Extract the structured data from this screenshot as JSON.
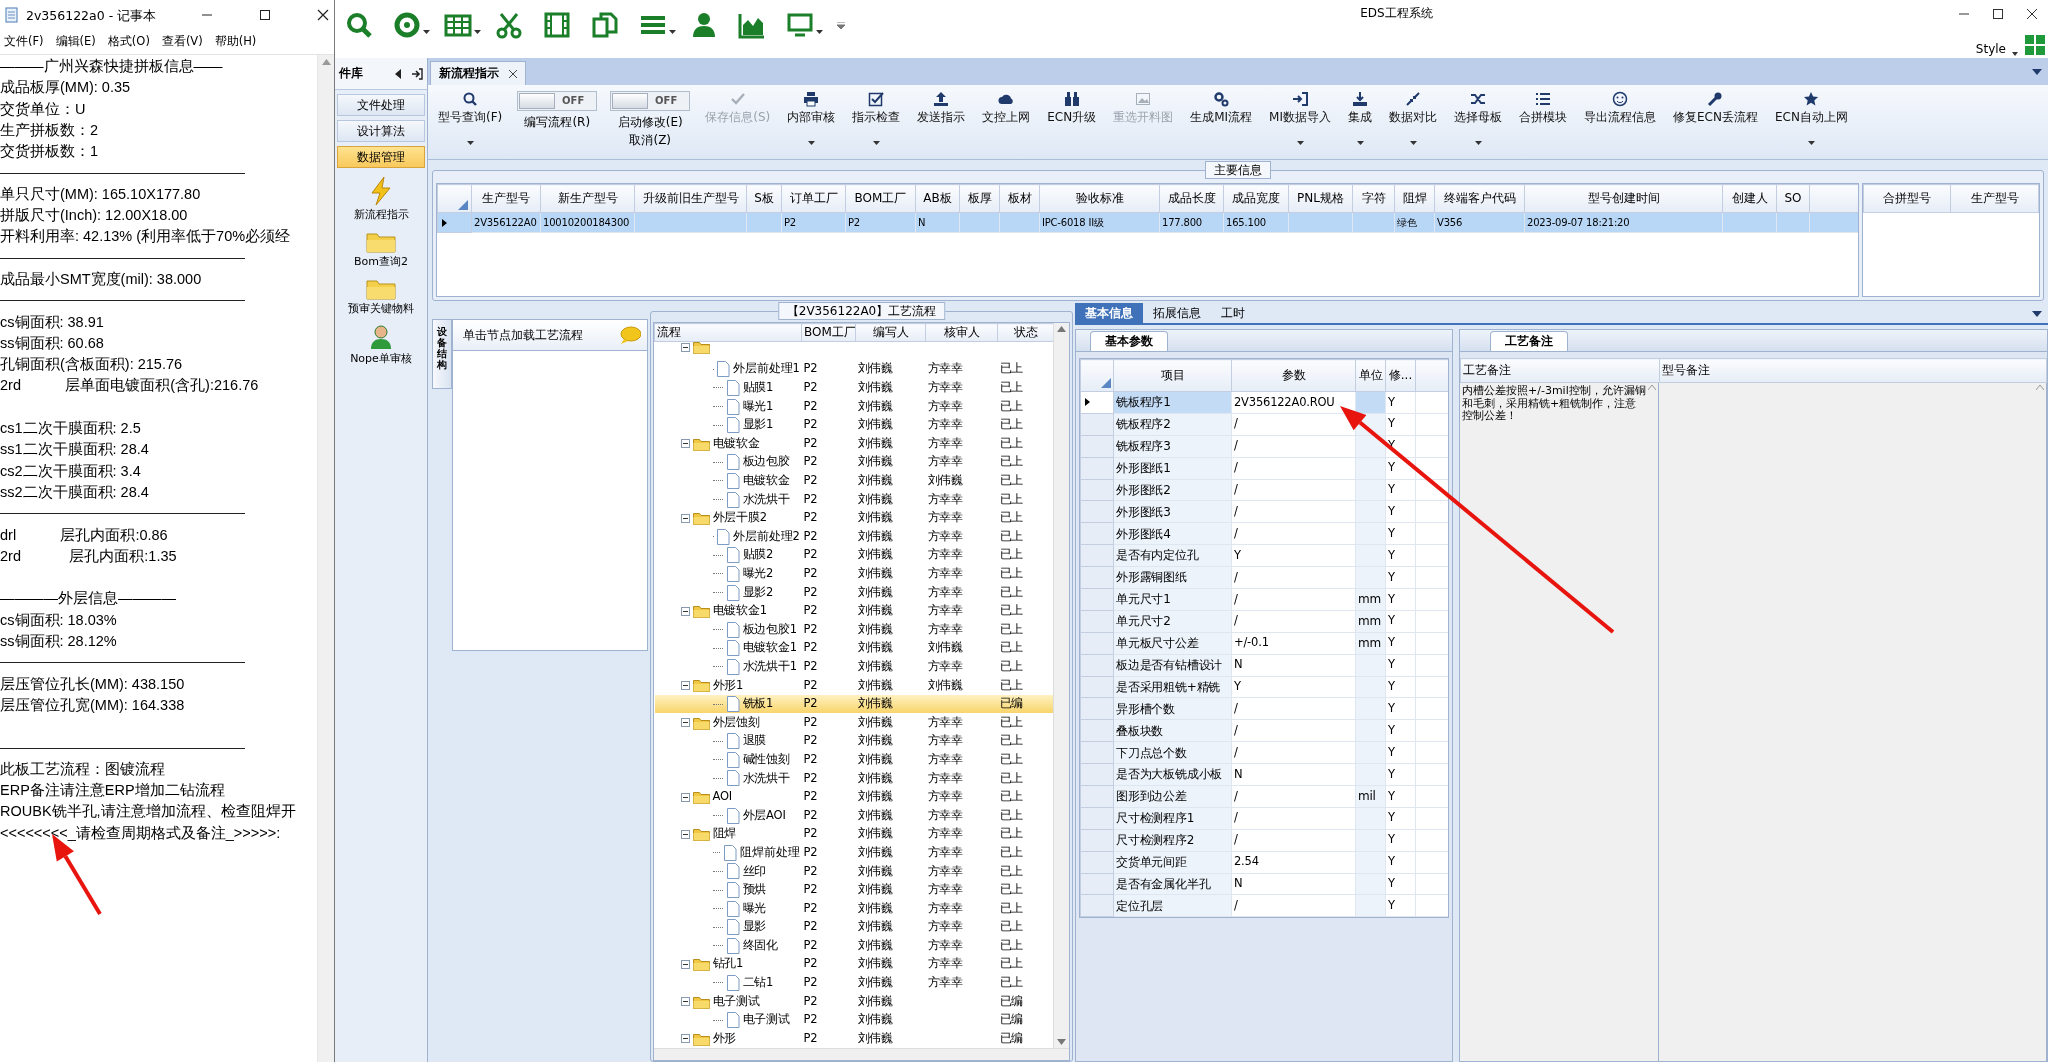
{
  "notepad": {
    "title": "2v356122a0 - 记事本",
    "menu": [
      "文件(F)",
      "编辑(E)",
      "格式(O)",
      "查看(V)",
      "帮助(H)"
    ],
    "lines": [
      {
        "kind": "text",
        "text": "———广州兴森快捷拼板信息——"
      },
      {
        "kind": "text",
        "text": "成品板厚(MM): 0.35"
      },
      {
        "kind": "text",
        "text": "交货单位：U"
      },
      {
        "kind": "text",
        "text": "生产拼板数：2"
      },
      {
        "kind": "text",
        "text": "交货拼板数：1"
      },
      {
        "kind": "rule"
      },
      {
        "kind": "text",
        "text": "单只尺寸(MM): 165.10X177.80"
      },
      {
        "kind": "text",
        "text": "拼版尺寸(Inch): 12.00X18.00"
      },
      {
        "kind": "text",
        "text": "开料利用率: 42.13% (利用率低于70%必须经"
      },
      {
        "kind": "rule"
      },
      {
        "kind": "text",
        "text": "成品最小SMT宽度(mil): 38.000"
      },
      {
        "kind": "rule"
      },
      {
        "kind": "text",
        "text": "cs铜面积: 38.91"
      },
      {
        "kind": "text",
        "text": "ss铜面积: 60.68"
      },
      {
        "kind": "text",
        "text": "孔铜面积(含板面积): 215.76"
      },
      {
        "kind": "text",
        "text": "2rd           层单面电镀面积(含孔):216.76"
      },
      {
        "kind": "blank"
      },
      {
        "kind": "text",
        "text": "cs1二次干膜面积: 2.5"
      },
      {
        "kind": "text",
        "text": "ss1二次干膜面积: 28.4"
      },
      {
        "kind": "text",
        "text": "cs2二次干膜面积: 3.4"
      },
      {
        "kind": "text",
        "text": "ss2二次干膜面积: 28.4"
      },
      {
        "kind": "rule"
      },
      {
        "kind": "text",
        "text": "drl           层孔内面积:0.86"
      },
      {
        "kind": "text",
        "text": "2rd            层孔内面积:1.35"
      },
      {
        "kind": "blank"
      },
      {
        "kind": "text",
        "text": "————外层信息————"
      },
      {
        "kind": "text",
        "text": "cs铜面积: 18.03%"
      },
      {
        "kind": "text",
        "text": "ss铜面积: 28.12%"
      },
      {
        "kind": "rule"
      },
      {
        "kind": "text",
        "text": "层压管位孔长(MM): 438.150"
      },
      {
        "kind": "text",
        "text": "层压管位孔宽(MM): 164.338"
      },
      {
        "kind": "blank"
      },
      {
        "kind": "rule"
      },
      {
        "kind": "text",
        "text": "此板工艺流程：图镀流程"
      },
      {
        "kind": "text",
        "text": "ERP备注请注意ERP增加二钻流程"
      },
      {
        "kind": "text",
        "text": "ROUBK铣半孔,请注意增加流程、检查阻焊开"
      },
      {
        "kind": "text",
        "text": "<<<<<<<<_请检查周期格式及备注_>>>>>:"
      }
    ]
  },
  "app": {
    "title": "EDS工程系统",
    "style_menu": "Style"
  },
  "nav": {
    "header": "件库",
    "items": [
      {
        "label": "文件处理",
        "selected": false
      },
      {
        "label": "设计算法",
        "selected": false
      },
      {
        "label": "数据管理",
        "selected": true
      }
    ],
    "shortcuts": [
      {
        "label": "新流程指示"
      },
      {
        "label": "Bom查询2"
      },
      {
        "label": "预审关键物料"
      },
      {
        "label": "Nope单审核"
      }
    ]
  },
  "doc_tabs": [
    {
      "label": "新流程指示",
      "selected": true
    }
  ],
  "ribbon": [
    {
      "kind": "button",
      "label": "型号查询(F)",
      "menu": true,
      "disabled": false
    },
    {
      "kind": "toggle",
      "label": "编写流程(R)",
      "state_text": "OFF",
      "on": false
    },
    {
      "kind": "toggle",
      "label": "启动修改(E)",
      "label_2": "取消(Z)",
      "state_text": "OFF",
      "on": false
    },
    {
      "kind": "button",
      "label": "保存信息(S)",
      "menu": false,
      "disabled": true
    },
    {
      "kind": "button",
      "label": "内部审核",
      "menu": true,
      "disabled": false
    },
    {
      "kind": "button",
      "label": "指示检查",
      "menu": true,
      "disabled": false
    },
    {
      "kind": "button",
      "label": "发送指示",
      "menu": false,
      "disabled": false
    },
    {
      "kind": "button",
      "label": "文控上网",
      "menu": false,
      "disabled": false
    },
    {
      "kind": "button",
      "label": "ECN升级",
      "menu": false,
      "disabled": false
    },
    {
      "kind": "button",
      "label": "重选开料图",
      "menu": false,
      "disabled": true
    },
    {
      "kind": "button",
      "label": "生成MI流程",
      "menu": false,
      "disabled": false
    },
    {
      "kind": "button",
      "label": "MI数据导入",
      "menu": true,
      "disabled": false
    },
    {
      "kind": "button",
      "label": "集成",
      "menu": true,
      "disabled": false
    },
    {
      "kind": "button",
      "label": "数据对比",
      "menu": true,
      "disabled": false
    },
    {
      "kind": "button",
      "label": "选择母板",
      "menu": true,
      "disabled": false
    },
    {
      "kind": "button",
      "label": "合拼模块",
      "menu": false,
      "disabled": false
    },
    {
      "kind": "button",
      "label": "导出流程信息",
      "menu": false,
      "disabled": false
    },
    {
      "kind": "button",
      "label": "修复ECN丢流程",
      "menu": false,
      "disabled": false
    },
    {
      "kind": "button",
      "label": "ECN自动上网",
      "menu": true,
      "disabled": false
    }
  ],
  "main_info": {
    "legend": "主要信息",
    "columns": [
      "生产型号",
      "新生产型号",
      "升级前旧生产型号",
      "S板",
      "订单工厂",
      "BOM工厂",
      "AB板",
      "板厚",
      "板材",
      "验收标准",
      "成品长度",
      "成品宽度",
      "PNL规格",
      "字符",
      "阻焊",
      "终端客户代码",
      "型号创建时间",
      "创建人",
      "SO"
    ],
    "rows": [
      {
        "selected": true,
        "cells": [
          "2V356122A0",
          "10010200184300",
          null,
          null,
          "P2",
          "P2",
          "N",
          null,
          null,
          "IPC-6018 II级",
          "177.800",
          "165.100",
          null,
          null,
          "绿色",
          "V356",
          "2023-09-07 18:21:20",
          null,
          null
        ]
      }
    ],
    "side_columns": [
      "合拼型号",
      "生产型号"
    ]
  },
  "process": {
    "side_tab": "设备结构",
    "hint": "单击节点加载工艺流程",
    "legend": "【2V356122A0】工艺流程",
    "columns": [
      "流程",
      "BOM工厂",
      "编写人",
      "核审人",
      "状态"
    ],
    "tree": [
      {
        "expanded": true,
        "selected": false,
        "children": [
          {
            "label": "外层前处理1",
            "bom": "P2",
            "author": "刘伟巍",
            "reviewer": "方幸幸",
            "status": "已上",
            "selected": false
          },
          {
            "label": "贴膜1",
            "bom": "P2",
            "author": "刘伟巍",
            "reviewer": "方幸幸",
            "status": "已上",
            "selected": false
          },
          {
            "label": "曝光1",
            "bom": "P2",
            "author": "刘伟巍",
            "reviewer": "方幸幸",
            "status": "已上",
            "selected": false
          },
          {
            "label": "显影1",
            "bom": "P2",
            "author": "刘伟巍",
            "reviewer": "方幸幸",
            "status": "已上",
            "selected": false
          }
        ]
      },
      {
        "label": "电镀软金",
        "bom": "P2",
        "author": "刘伟巍",
        "reviewer": "方幸幸",
        "status": "已上",
        "expanded": true,
        "selected": false,
        "children": [
          {
            "label": "板边包胶",
            "bom": "P2",
            "author": "刘伟巍",
            "reviewer": "方幸幸",
            "status": "已上",
            "selected": false
          },
          {
            "label": "电镀软金",
            "bom": "P2",
            "author": "刘伟巍",
            "reviewer": "刘伟巍",
            "status": "已上",
            "selected": false
          },
          {
            "label": "水洗烘干",
            "bom": "P2",
            "author": "刘伟巍",
            "reviewer": "方幸幸",
            "status": "已上",
            "selected": false
          }
        ]
      },
      {
        "label": "外层干膜2",
        "bom": "P2",
        "author": "刘伟巍",
        "reviewer": "方幸幸",
        "status": "已上",
        "expanded": true,
        "selected": false,
        "children": [
          {
            "label": "外层前处理2",
            "bom": "P2",
            "author": "刘伟巍",
            "reviewer": "方幸幸",
            "status": "已上",
            "selected": false
          },
          {
            "label": "贴膜2",
            "bom": "P2",
            "author": "刘伟巍",
            "reviewer": "方幸幸",
            "status": "已上",
            "selected": false
          },
          {
            "label": "曝光2",
            "bom": "P2",
            "author": "刘伟巍",
            "reviewer": "方幸幸",
            "status": "已上",
            "selected": false
          },
          {
            "label": "显影2",
            "bom": "P2",
            "author": "刘伟巍",
            "reviewer": "方幸幸",
            "status": "已上",
            "selected": false
          }
        ]
      },
      {
        "label": "电镀软金1",
        "bom": "P2",
        "author": "刘伟巍",
        "reviewer": "方幸幸",
        "status": "已上",
        "expanded": true,
        "selected": false,
        "children": [
          {
            "label": "板边包胶1",
            "bom": "P2",
            "author": "刘伟巍",
            "reviewer": "方幸幸",
            "status": "已上",
            "selected": false
          },
          {
            "label": "电镀软金1",
            "bom": "P2",
            "author": "刘伟巍",
            "reviewer": "刘伟巍",
            "status": "已上",
            "selected": false
          },
          {
            "label": "水洗烘干1",
            "bom": "P2",
            "author": "刘伟巍",
            "reviewer": "方幸幸",
            "status": "已上",
            "selected": false
          }
        ]
      },
      {
        "label": "外形1",
        "bom": "P2",
        "author": "刘伟巍",
        "reviewer": "刘伟巍",
        "status": "已上",
        "expanded": true,
        "selected": false,
        "children": [
          {
            "label": "铣板1",
            "bom": "P2",
            "author": "刘伟巍",
            "status": "已编",
            "selected": true
          }
        ]
      },
      {
        "label": "外层蚀刻",
        "bom": "P2",
        "author": "刘伟巍",
        "reviewer": "方幸幸",
        "status": "已上",
        "expanded": true,
        "selected": false,
        "children": [
          {
            "label": "退膜",
            "bom": "P2",
            "author": "刘伟巍",
            "reviewer": "方幸幸",
            "status": "已上",
            "selected": false
          },
          {
            "label": "碱性蚀刻",
            "bom": "P2",
            "author": "刘伟巍",
            "reviewer": "方幸幸",
            "status": "已上",
            "selected": false
          },
          {
            "label": "水洗烘干",
            "bom": "P2",
            "author": "刘伟巍",
            "reviewer": "方幸幸",
            "status": "已上",
            "selected": false
          }
        ]
      },
      {
        "label": "AOI",
        "bom": "P2",
        "author": "刘伟巍",
        "reviewer": "方幸幸",
        "status": "已上",
        "expanded": true,
        "selected": false,
        "children": [
          {
            "label": "外层AOI",
            "bom": "P2",
            "author": "刘伟巍",
            "reviewer": "方幸幸",
            "status": "已上",
            "selected": false
          }
        ]
      },
      {
        "label": "阻焊",
        "bom": "P2",
        "author": "刘伟巍",
        "reviewer": "方幸幸",
        "status": "已上",
        "expanded": true,
        "selected": false,
        "children": [
          {
            "label": "阻焊前处理",
            "bom": "P2",
            "author": "刘伟巍",
            "reviewer": "方幸幸",
            "status": "已上",
            "selected": false
          },
          {
            "label": "丝印",
            "bom": "P2",
            "author": "刘伟巍",
            "reviewer": "方幸幸",
            "status": "已上",
            "selected": false
          },
          {
            "label": "预烘",
            "bom": "P2",
            "author": "刘伟巍",
            "reviewer": "方幸幸",
            "status": "已上",
            "selected": false
          },
          {
            "label": "曝光",
            "bom": "P2",
            "author": "刘伟巍",
            "reviewer": "方幸幸",
            "status": "已上",
            "selected": false
          },
          {
            "label": "显影",
            "bom": "P2",
            "author": "刘伟巍",
            "reviewer": "方幸幸",
            "status": "已上",
            "selected": false
          },
          {
            "label": "终固化",
            "bom": "P2",
            "author": "刘伟巍",
            "reviewer": "方幸幸",
            "status": "已上",
            "selected": false
          }
        ]
      },
      {
        "label": "钻孔1",
        "bom": "P2",
        "author": "刘伟巍",
        "reviewer": "方幸幸",
        "status": "已上",
        "expanded": true,
        "selected": false,
        "children": [
          {
            "label": "二钻1",
            "bom": "P2",
            "author": "刘伟巍",
            "reviewer": "方幸幸",
            "status": "已上",
            "selected": false
          }
        ]
      },
      {
        "label": "电子测试",
        "bom": "P2",
        "author": "刘伟巍",
        "status": "已编",
        "expanded": true,
        "selected": false,
        "children": [
          {
            "label": "电子测试",
            "bom": "P2",
            "author": "刘伟巍",
            "status": "已编",
            "selected": false
          }
        ]
      },
      {
        "label": "外形",
        "bom": "P2",
        "author": "刘伟巍",
        "status": "已编",
        "expanded": true,
        "selected": false
      }
    ]
  },
  "details": {
    "tabs": [
      {
        "label": "基本信息",
        "selected": true
      },
      {
        "label": "拓展信息",
        "selected": false
      },
      {
        "label": "工时",
        "selected": false
      }
    ],
    "params": {
      "tab": "基本参数",
      "columns": [
        "项目",
        "参数",
        "单位",
        "修..."
      ],
      "rows": [
        {
          "item": "铣板程序1",
          "value": "2V356122A0.ROU",
          "flag": "Y",
          "selected": true
        },
        {
          "item": "铣板程序2",
          "value": "/",
          "flag": "Y",
          "selected": false
        },
        {
          "item": "铣板程序3",
          "value": "/",
          "flag": "Y",
          "selected": false
        },
        {
          "item": "外形图纸1",
          "value": "/",
          "flag": "Y",
          "selected": false
        },
        {
          "item": "外形图纸2",
          "value": "/",
          "flag": "Y",
          "selected": false
        },
        {
          "item": "外形图纸3",
          "value": "/",
          "flag": "Y",
          "selected": false
        },
        {
          "item": "外形图纸4",
          "value": "/",
          "flag": "Y",
          "selected": false
        },
        {
          "item": "是否有内定位孔",
          "value": "Y",
          "flag": "Y",
          "selected": false
        },
        {
          "item": "外形露铜图纸",
          "value": "/",
          "flag": "Y",
          "selected": false
        },
        {
          "item": "单元尺寸1",
          "value": "/",
          "unit": "mm",
          "flag": "Y",
          "selected": false
        },
        {
          "item": "单元尺寸2",
          "value": "/",
          "unit": "mm",
          "flag": "Y",
          "selected": false
        },
        {
          "item": "单元板尺寸公差",
          "value": "+/-0.1",
          "unit": "mm",
          "flag": "Y",
          "selected": false
        },
        {
          "item": "板边是否有钻槽设计",
          "value": "N",
          "flag": "Y",
          "selected": false
        },
        {
          "item": "是否采用粗铣+精铣",
          "value": "Y",
          "flag": "Y",
          "selected": false
        },
        {
          "item": "异形槽个数",
          "value": "/",
          "flag": "Y",
          "selected": false
        },
        {
          "item": "叠板块数",
          "value": "/",
          "flag": "Y",
          "selected": false
        },
        {
          "item": "下刀点总个数",
          "value": "/",
          "flag": "Y",
          "selected": false
        },
        {
          "item": "是否为大板铣成小板",
          "value": "N",
          "flag": "Y",
          "selected": false
        },
        {
          "item": "图形到边公差",
          "value": "/",
          "unit": "mil",
          "flag": "Y",
          "selected": false
        },
        {
          "item": "尺寸检测程序1",
          "value": "/",
          "flag": "Y",
          "selected": false
        },
        {
          "item": "尺寸检测程序2",
          "value": "/",
          "flag": "Y",
          "selected": false
        },
        {
          "item": "交货单元间距",
          "value": "2.54",
          "flag": "Y",
          "selected": false
        },
        {
          "item": "是否有金属化半孔",
          "value": "N",
          "flag": "Y",
          "selected": false
        },
        {
          "item": "定位孔层",
          "value": "/",
          "flag": "Y",
          "selected": false
        }
      ]
    },
    "notes": {
      "tab": "工艺备注",
      "columns": [
        "工艺备注",
        "型号备注"
      ],
      "process_note": "内槽公差按照+/-3mil控制，允许漏铜和毛刺，采用精铣+粗铣制作，注意控制公差！"
    }
  },
  "annotations": [
    {
      "kind": "arrow",
      "color": "#e8140e"
    },
    {
      "kind": "arrow",
      "color": "#e8140e"
    }
  ]
}
